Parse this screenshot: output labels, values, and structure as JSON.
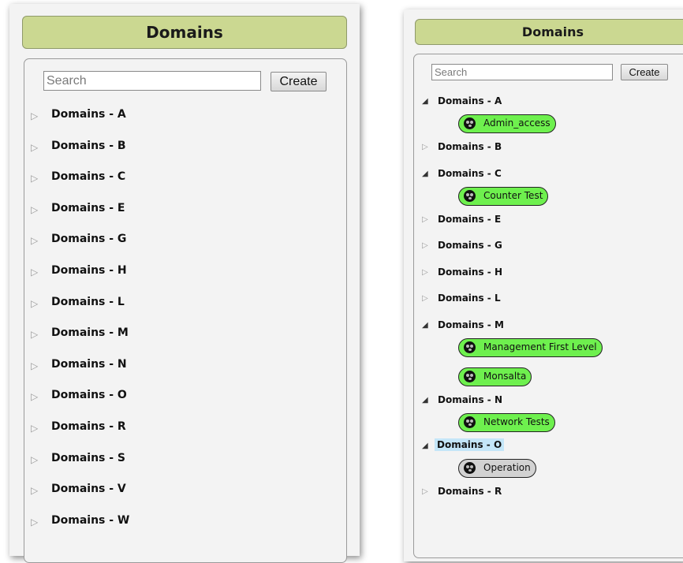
{
  "left_panel": {
    "title": "Domains",
    "search_placeholder": "Search",
    "create_label": "Create",
    "items": [
      "Domains - A",
      "Domains - B",
      "Domains - C",
      "Domains - E",
      "Domains - G",
      "Domains - H",
      "Domains - L",
      "Domains - M",
      "Domains - N",
      "Domains - O",
      "Domains - R",
      "Domains - S",
      "Domains - V",
      "Domains - W"
    ]
  },
  "right_panel": {
    "title": "Domains",
    "search_placeholder": "Search",
    "create_label": "Create",
    "rows": [
      {
        "type": "group",
        "label": "Domains - A",
        "expanded": true
      },
      {
        "type": "leaf",
        "label": "Admin_access",
        "status": "green"
      },
      {
        "type": "group",
        "label": "Domains - B",
        "expanded": false
      },
      {
        "type": "group",
        "label": "Domains - C",
        "expanded": true
      },
      {
        "type": "leaf",
        "label": "Counter Test",
        "status": "green"
      },
      {
        "type": "group",
        "label": "Domains - E",
        "expanded": false
      },
      {
        "type": "group",
        "label": "Domains - G",
        "expanded": false
      },
      {
        "type": "group",
        "label": "Domains - H",
        "expanded": false
      },
      {
        "type": "group",
        "label": "Domains - L",
        "expanded": false
      },
      {
        "type": "group",
        "label": "Domains - M",
        "expanded": true
      },
      {
        "type": "leaf",
        "label": "Management First Level",
        "status": "green"
      },
      {
        "type": "leaf",
        "label": "Monsalta",
        "status": "green"
      },
      {
        "type": "group",
        "label": "Domains - N",
        "expanded": true
      },
      {
        "type": "leaf",
        "label": "Network Tests",
        "status": "green"
      },
      {
        "type": "group",
        "label": "Domains - O",
        "expanded": true,
        "selected": true
      },
      {
        "type": "leaf",
        "label": "Operation",
        "status": "grey"
      },
      {
        "type": "group",
        "label": "Domains - R",
        "expanded": false
      }
    ]
  },
  "icons": {
    "collapsed": "▷",
    "expanded": "◢",
    "leaf": "skull-icon"
  },
  "colors": {
    "header_bg": "#cbd891",
    "leaf_active": "#6ef04e",
    "leaf_inactive": "#d2d2d2",
    "selected_bg": "#c4e6f8"
  }
}
